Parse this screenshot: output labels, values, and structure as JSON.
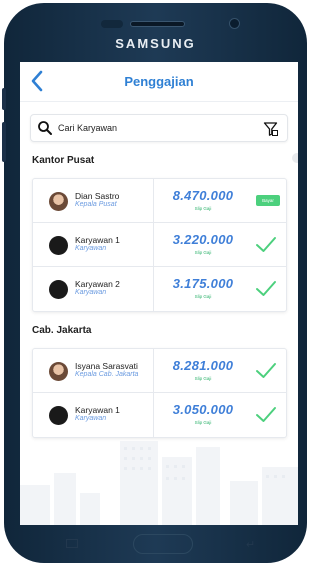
{
  "device": {
    "brand": "SAMSUNG"
  },
  "appbar": {
    "title": "Penggajian",
    "back_icon": "chevron-left-icon"
  },
  "search": {
    "placeholder": "Cari Karyawan",
    "search_icon": "search-icon",
    "filter_icon": "filter-icon"
  },
  "colors": {
    "accent": "#2f80d4",
    "amount": "#3f7fd8",
    "success": "#4cd07d",
    "role": "#6b9be0"
  },
  "sections": [
    {
      "title": "Kantor Pusat",
      "rows": [
        {
          "name": "Dian Sastro",
          "role": "Kepala Pusat",
          "amount": "8.470.000",
          "slip": "Slip Gaji",
          "status": "badge",
          "badge_text": "Bayar",
          "avatar": "photo"
        },
        {
          "name": "Karyawan 1",
          "role": "Karyawan",
          "amount": "3.220.000",
          "slip": "Slip Gaji",
          "status": "check",
          "avatar": "placeholder"
        },
        {
          "name": "Karyawan 2",
          "role": "Karyawan",
          "amount": "3.175.000",
          "slip": "Slip Gaji",
          "status": "check",
          "avatar": "placeholder"
        }
      ]
    },
    {
      "title": "Cab. Jakarta",
      "rows": [
        {
          "name": "Isyana Sarasvati",
          "role": "Kepala Cab. Jakarta",
          "amount": "8.281.000",
          "slip": "Slip Gaji",
          "status": "check",
          "avatar": "photo"
        },
        {
          "name": "Karyawan 1",
          "role": "Karyawan",
          "amount": "3.050.000",
          "slip": "Slip Gaji",
          "status": "check",
          "avatar": "placeholder"
        }
      ]
    }
  ]
}
